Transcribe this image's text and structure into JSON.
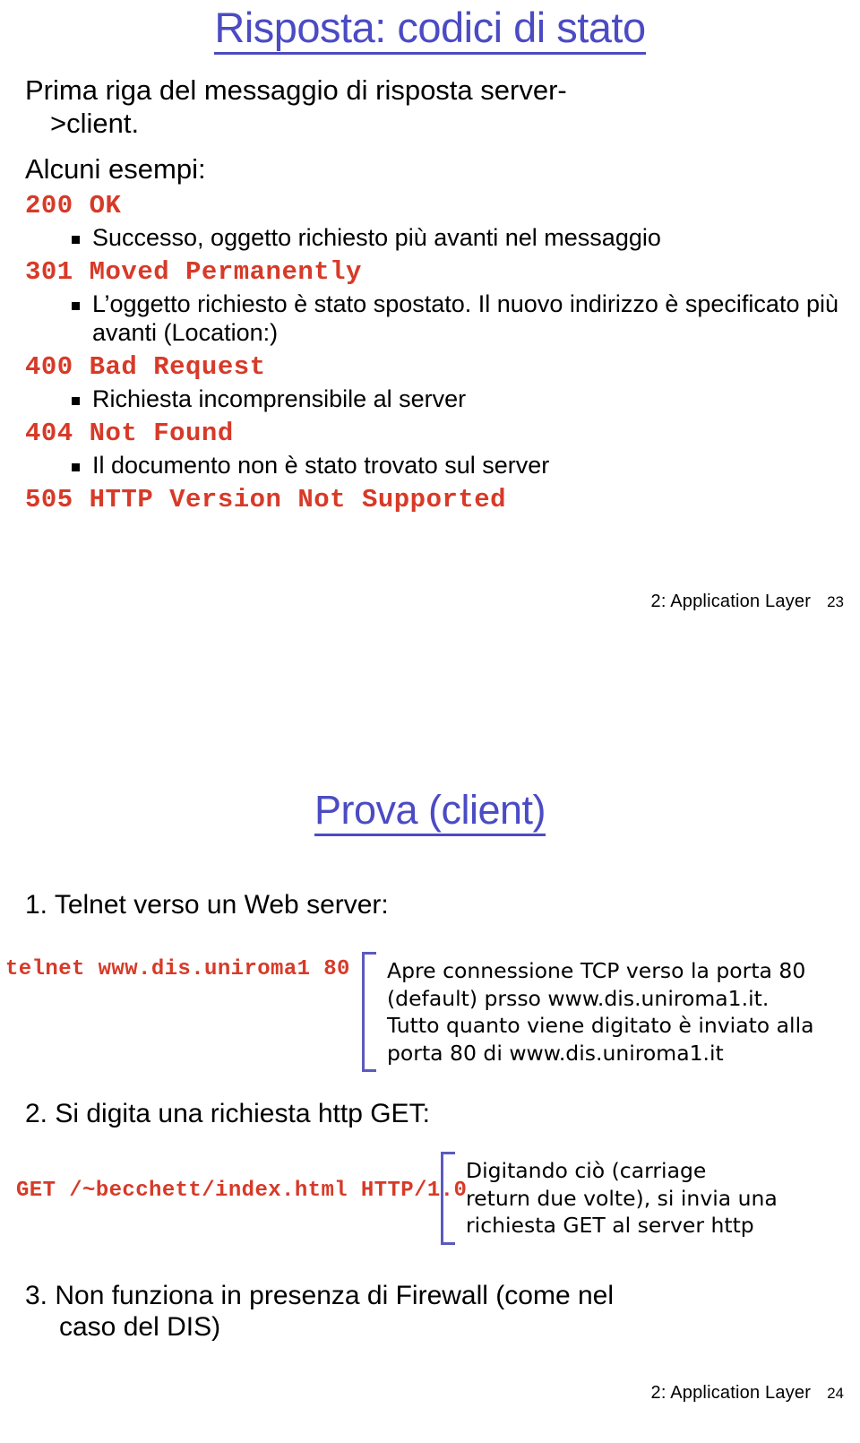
{
  "slide1": {
    "title": "Risposta: codici di stato",
    "lead_line1": "Prima riga del messaggio di risposta server-",
    "lead_line2": ">client.",
    "lead2": "Alcuni esempi:",
    "codes": [
      {
        "code": "200 OK",
        "desc": "Successo, oggetto richiesto più avanti nel messaggio"
      },
      {
        "code": "301 Moved Permanently",
        "desc": "L’oggetto richiesto è stato spostato. Il nuovo indirizzo è specificato più avanti (Location:)"
      },
      {
        "code": "400 Bad Request",
        "desc": "Richiesta incomprensibile al server"
      },
      {
        "code": "404 Not Found",
        "desc": "Il documento non è stato trovato sul server"
      },
      {
        "code": "505 HTTP Version Not Supported",
        "desc": ""
      }
    ],
    "footer_label": "2: Application Layer",
    "footer_page": "23"
  },
  "slide2": {
    "title": "Prova  (client)",
    "step1": "1. Telnet verso un Web server:",
    "cmd1": "telnet www.dis.uniroma1 80",
    "callout1": [
      "Apre connessione TCP verso la porta 80",
      "(default) prsso www.dis.uniroma1.it.",
      "Tutto quanto viene digitato è inviato alla",
      "porta 80 di www.dis.uniroma1.it"
    ],
    "step2": "2. Si digita una richiesta http GET:",
    "cmd2": "GET /~becchett/index.html HTTP/1.0",
    "callout2": [
      "Digitando ciò (carriage",
      "return due volte), si invia una",
      "richiesta GET al server http"
    ],
    "step3_line1": "3. Non funziona in presenza di Firewall (come nel",
    "step3_line2": "caso del DIS)",
    "footer_label": "2: Application Layer",
    "footer_page": "24"
  },
  "colors": {
    "title_blue": "#4b4bc4",
    "code_red": "#d73a28",
    "bracket_blue": "#5b5bbd",
    "text_black": "#000000",
    "background": "#ffffff"
  }
}
